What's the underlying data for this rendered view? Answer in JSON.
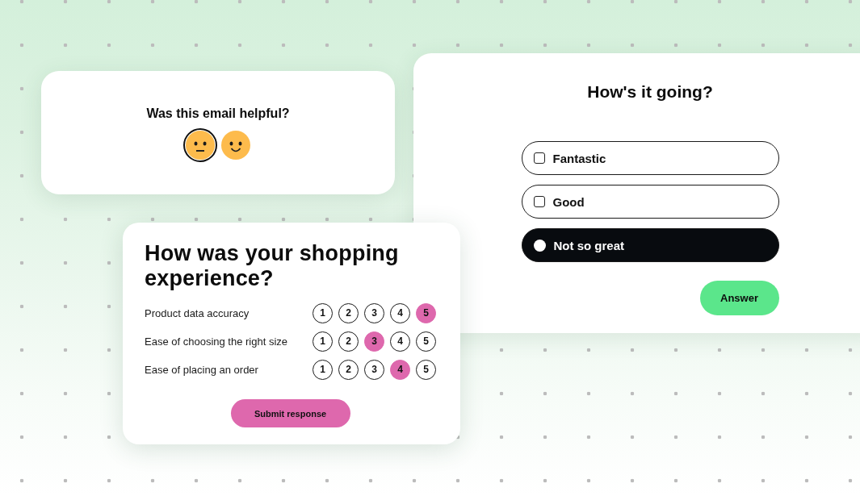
{
  "email_feedback": {
    "question": "Was this email helpful?",
    "faces": [
      {
        "kind": "neutral",
        "selected": true
      },
      {
        "kind": "smile",
        "selected": false
      }
    ]
  },
  "mood_poll": {
    "title": "How's it going?",
    "options": [
      {
        "label": "Fantastic",
        "selected": false
      },
      {
        "label": "Good",
        "selected": false
      },
      {
        "label": "Not so great",
        "selected": true
      }
    ],
    "answer_button": "Answer"
  },
  "shopping_survey": {
    "title": "How was your shopping experience?",
    "rows": [
      {
        "label": "Product data accuracy",
        "options": [
          {
            "label": "1",
            "selected": false
          },
          {
            "label": "2",
            "selected": false
          },
          {
            "label": "3",
            "selected": false
          },
          {
            "label": "4",
            "selected": false
          },
          {
            "label": "5",
            "selected": true
          }
        ]
      },
      {
        "label": "Ease of choosing the right size",
        "options": [
          {
            "label": "1",
            "selected": false
          },
          {
            "label": "2",
            "selected": false
          },
          {
            "label": "3",
            "selected": true
          },
          {
            "label": "4",
            "selected": false
          },
          {
            "label": "5",
            "selected": false
          }
        ]
      },
      {
        "label": "Ease of placing an order",
        "options": [
          {
            "label": "1",
            "selected": false
          },
          {
            "label": "2",
            "selected": false
          },
          {
            "label": "3",
            "selected": false
          },
          {
            "label": "4",
            "selected": true
          },
          {
            "label": "5",
            "selected": false
          }
        ]
      }
    ],
    "submit_button": "Submit response"
  }
}
